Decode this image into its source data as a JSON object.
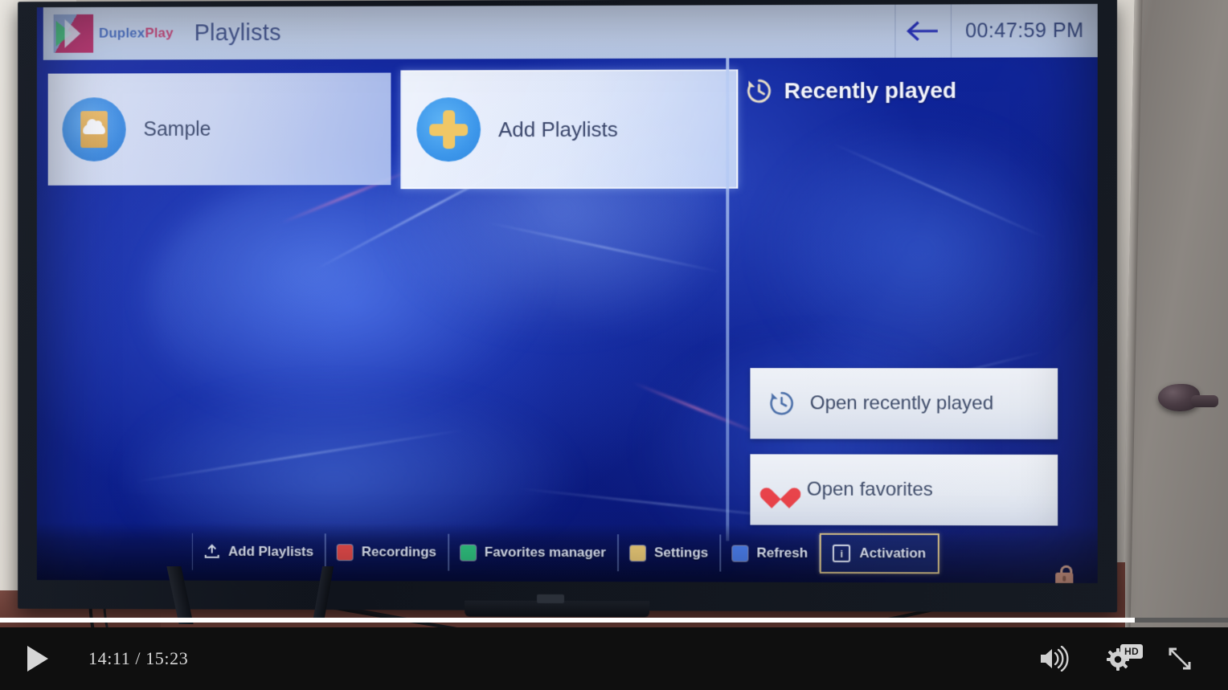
{
  "app": {
    "logo": {
      "duplex": "Duplex",
      "play": "Play",
      "icon": "duplexplay-logo-icon"
    },
    "page_title": "Playlists",
    "back_icon": "back-arrow-icon",
    "clock": "00:47:59 PM"
  },
  "playlists": [
    {
      "label": "Sample",
      "icon": "file-cloud-icon",
      "focused": false
    },
    {
      "label": "Add Playlists",
      "icon": "plus-icon",
      "focused": true
    }
  ],
  "recent_panel": {
    "heading": "Recently played",
    "heading_icon": "history-clock-icon",
    "buttons": [
      {
        "label": "Open recently played",
        "icon": "history-clock-icon"
      },
      {
        "label": "Open favorites",
        "icon": "heart-icon"
      }
    ]
  },
  "toolbar": [
    {
      "label": "Add Playlists",
      "icon": "upload-icon",
      "color": "",
      "focused": false
    },
    {
      "label": "Recordings",
      "icon": "square-icon",
      "color": "#e04a4a",
      "focused": false
    },
    {
      "label": "Favorites manager",
      "icon": "square-icon",
      "color": "#2fbf7e",
      "focused": false
    },
    {
      "label": "Settings",
      "icon": "square-icon",
      "color": "#e8c877",
      "focused": false
    },
    {
      "label": "Refresh",
      "icon": "square-icon",
      "color": "#4a7ce8",
      "focused": false
    },
    {
      "label": "Activation",
      "icon": "info-icon",
      "color": "",
      "focused": true
    }
  ],
  "status": {
    "lock_icon": "unlocked-padlock-icon"
  },
  "player": {
    "play_icon": "play-icon",
    "time": "14:11 / 15:23",
    "volume_icon": "volume-high-icon",
    "quality_icon": "settings-gear-icon",
    "quality_badge": "HD",
    "fullscreen_icon": "fullscreen-expand-icon",
    "progress_percent": 92
  },
  "colors": {
    "header_bg": "#c6d4ef",
    "screen_blue": "#1228a0",
    "focus_gold": "#d9c38a",
    "accent_blue": "#3d8ae0",
    "heart_red": "#e8434a"
  }
}
